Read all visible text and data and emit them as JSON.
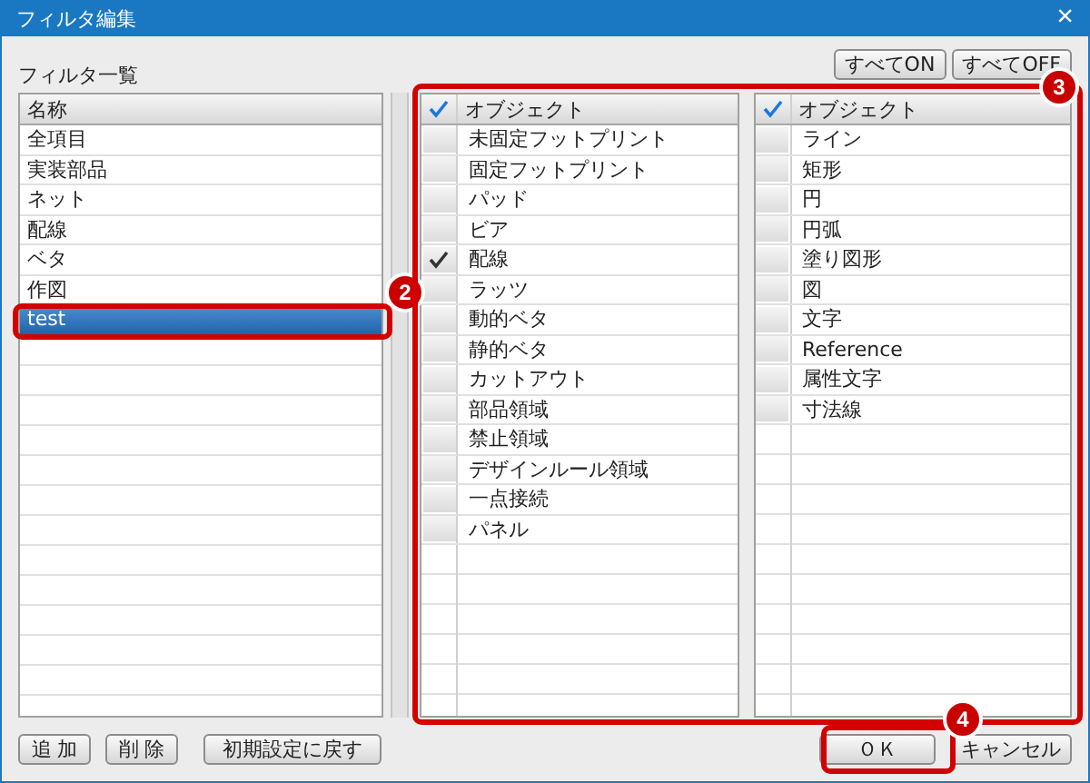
{
  "window": {
    "title": "フィルタ編集",
    "close": "×"
  },
  "filter_list": {
    "label": "フィルタ一覧",
    "header": "名称",
    "items": [
      {
        "name": "全項目",
        "selected": false
      },
      {
        "name": "実装部品",
        "selected": false
      },
      {
        "name": "ネット",
        "selected": false
      },
      {
        "name": "配線",
        "selected": false
      },
      {
        "name": "ベタ",
        "selected": false
      },
      {
        "name": "作図",
        "selected": false
      },
      {
        "name": "test",
        "selected": true
      }
    ]
  },
  "top_buttons": [
    "すべてON",
    "すべてOFF"
  ],
  "object_tables": [
    {
      "header": "オブジェクト",
      "items": [
        {
          "name": "未固定フットプリント",
          "checked": false
        },
        {
          "name": "固定フットプリント",
          "checked": false
        },
        {
          "name": "パッド",
          "checked": false
        },
        {
          "name": "ビア",
          "checked": false
        },
        {
          "name": "配線",
          "checked": true
        },
        {
          "name": "ラッツ",
          "checked": false
        },
        {
          "name": "動的ベタ",
          "checked": false
        },
        {
          "name": "静的ベタ",
          "checked": false
        },
        {
          "name": "カットアウト",
          "checked": false
        },
        {
          "name": "部品領域",
          "checked": false
        },
        {
          "name": "禁止領域",
          "checked": false
        },
        {
          "name": "デザインルール領域",
          "checked": false
        },
        {
          "name": "一点接続",
          "checked": false
        },
        {
          "name": "パネル",
          "checked": false
        }
      ]
    },
    {
      "header": "オブジェクト",
      "items": [
        {
          "name": "ライン",
          "checked": false
        },
        {
          "name": "矩形",
          "checked": false
        },
        {
          "name": "円",
          "checked": false
        },
        {
          "name": "円弧",
          "checked": false
        },
        {
          "name": "塗り図形",
          "checked": false
        },
        {
          "name": "図",
          "checked": false
        },
        {
          "name": "文字",
          "checked": false
        },
        {
          "name": "Reference",
          "checked": false
        },
        {
          "name": "属性文字",
          "checked": false
        },
        {
          "name": "寸法線",
          "checked": false
        }
      ]
    }
  ],
  "left_buttons": [
    "追 加",
    "削 除",
    "初期設定に戻す"
  ],
  "right_buttons": [
    "ＯＫ",
    "キャンセル"
  ],
  "annotations": [
    {
      "number": "2"
    },
    {
      "number": "3"
    },
    {
      "number": "4"
    }
  ]
}
